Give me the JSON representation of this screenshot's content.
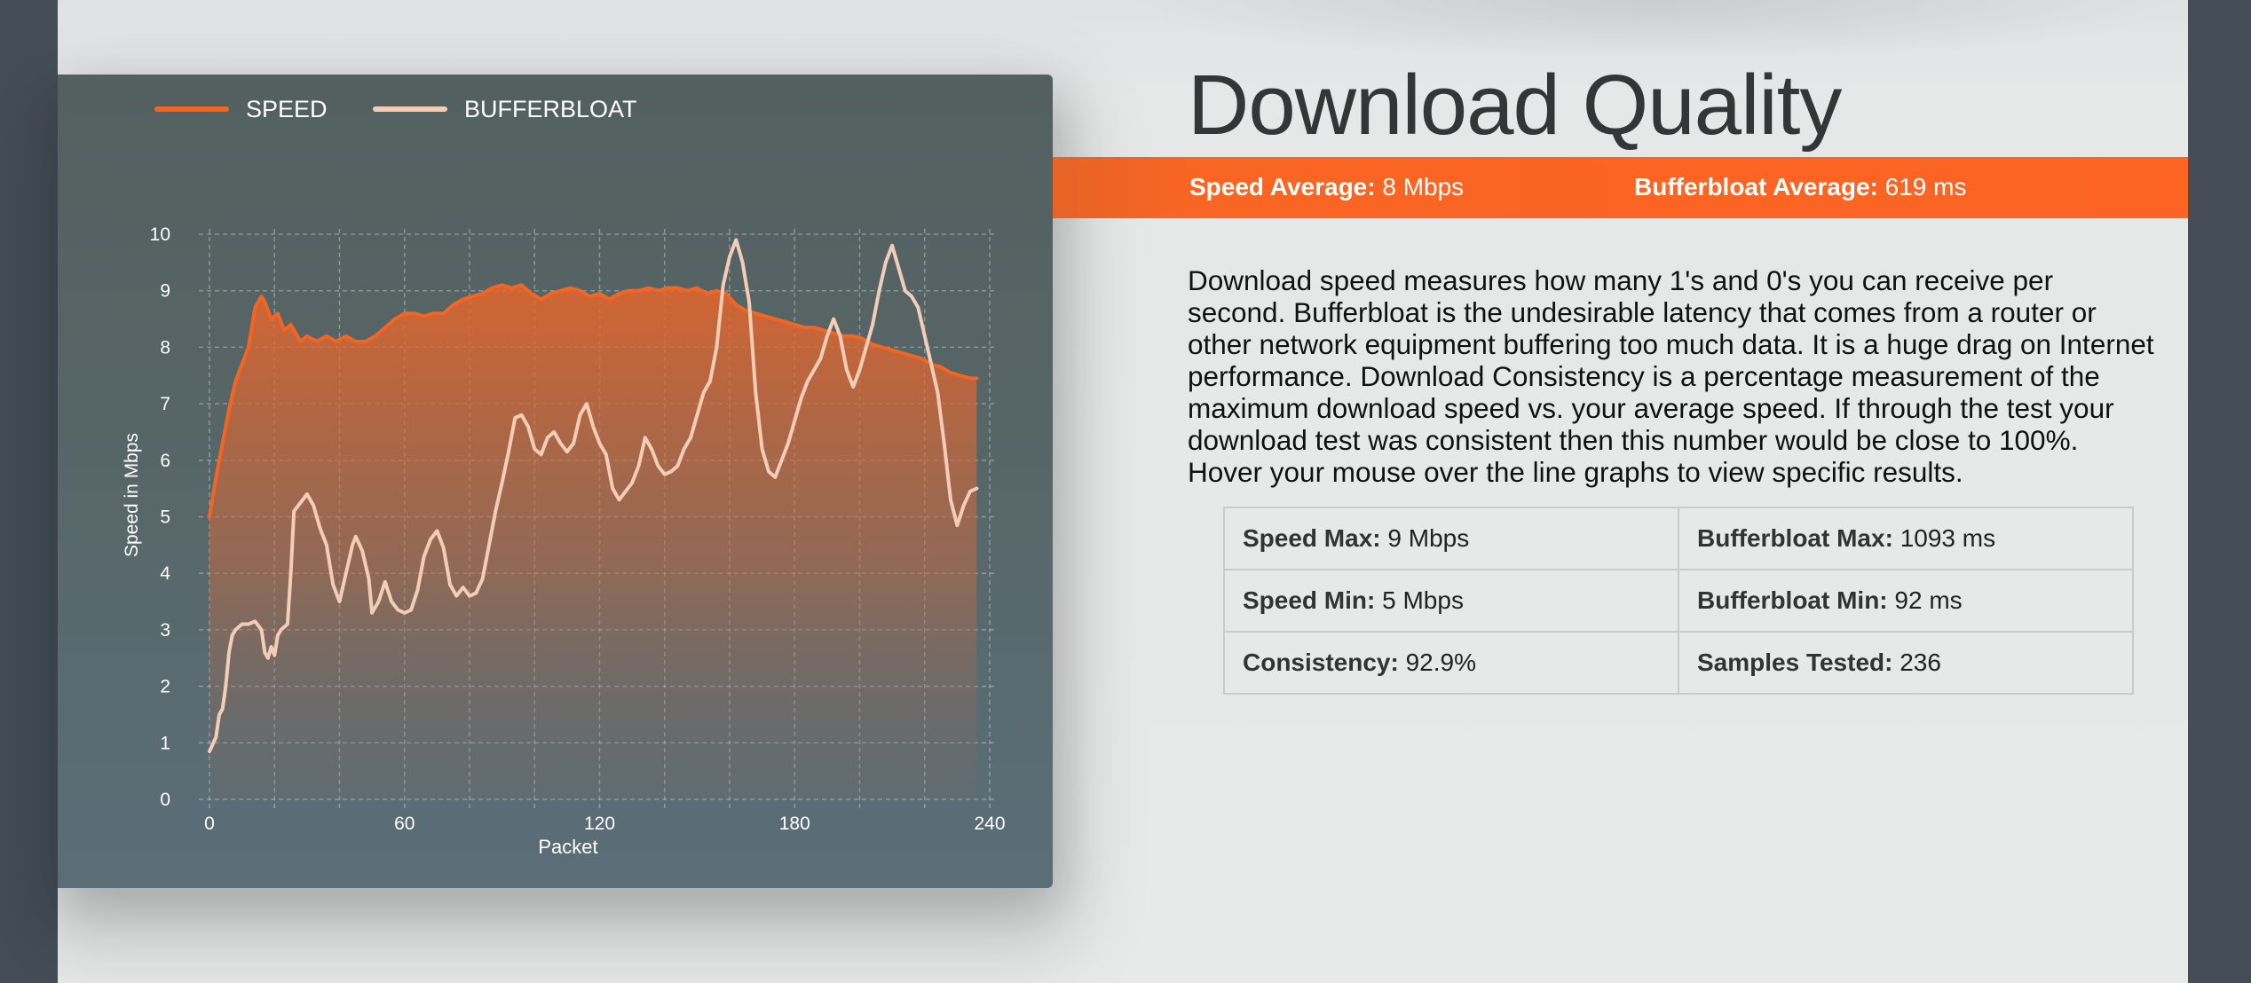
{
  "title": "Download Quality",
  "summary": {
    "speed_label": "Speed Average:",
    "speed_value": "8 Mbps",
    "bufferbloat_label": "Bufferbloat Average:",
    "bufferbloat_value": "619 ms"
  },
  "description": "Download speed measures how many 1's and 0's you can receive per second. Bufferbloat is the undesirable latency that comes from a router or other network equipment buffering too much data. It is a huge drag on Internet performance. Download Consistency is a percentage measurement of the maximum download speed vs. your average speed. If through the test your download test was consistent then this number would be close to 100%. Hover your mouse over the line graphs to view specific results.",
  "stats": [
    [
      {
        "label": "Speed Max:",
        "value": "9 Mbps"
      },
      {
        "label": "Bufferbloat Max:",
        "value": "1093 ms"
      }
    ],
    [
      {
        "label": "Speed Min:",
        "value": "5 Mbps"
      },
      {
        "label": "Bufferbloat Min:",
        "value": "92 ms"
      }
    ],
    [
      {
        "label": "Consistency:",
        "value": "92.9%"
      },
      {
        "label": "Samples Tested:",
        "value": "236"
      }
    ]
  ],
  "colors": {
    "accent": "#fd6423",
    "speed_line": "#f26522",
    "bufferbloat_line": "#f3cdb8",
    "chart_bg": "#566566"
  },
  "chart_data": {
    "type": "line",
    "title": "",
    "xlabel": "Packet",
    "ylabel": "Speed in Mbps",
    "xlim": [
      0,
      240
    ],
    "ylim": [
      0,
      10
    ],
    "x_ticks": [
      0,
      60,
      120,
      180,
      240
    ],
    "y_ticks": [
      0,
      1,
      2,
      3,
      4,
      5,
      6,
      7,
      8,
      9,
      10
    ],
    "grid": true,
    "legend_position": "top-left",
    "series": [
      {
        "name": "SPEED",
        "color": "#f26522",
        "fill": true,
        "x": [
          0,
          2,
          4,
          6,
          8,
          10,
          12,
          14,
          16,
          17,
          19,
          21,
          23,
          25,
          28,
          30,
          33,
          36,
          39,
          42,
          45,
          48,
          51,
          54,
          57,
          60,
          63,
          66,
          69,
          72,
          75,
          78,
          81,
          84,
          87,
          90,
          93,
          96,
          99,
          102,
          105,
          108,
          111,
          114,
          117,
          120,
          123,
          126,
          129,
          132,
          135,
          138,
          141,
          144,
          147,
          150,
          153,
          156,
          159,
          162,
          165,
          168,
          171,
          174,
          177,
          180,
          183,
          186,
          189,
          192,
          195,
          198,
          201,
          204,
          207,
          210,
          213,
          216,
          219,
          222,
          225,
          228,
          231,
          234,
          236
        ],
        "y": [
          5,
          5.7,
          6.3,
          6.9,
          7.4,
          7.7,
          8.0,
          8.7,
          8.9,
          8.8,
          8.5,
          8.6,
          8.3,
          8.4,
          8.1,
          8.2,
          8.1,
          8.2,
          8.1,
          8.2,
          8.1,
          8.1,
          8.2,
          8.35,
          8.5,
          8.6,
          8.6,
          8.55,
          8.6,
          8.6,
          8.75,
          8.85,
          8.9,
          8.95,
          9.05,
          9.1,
          9.05,
          9.1,
          8.95,
          8.85,
          8.95,
          9.0,
          9.05,
          9.0,
          8.9,
          8.95,
          8.85,
          8.95,
          9.0,
          9.0,
          9.05,
          9.0,
          9.05,
          9.05,
          9.0,
          9.05,
          8.95,
          9.0,
          8.95,
          8.75,
          8.65,
          8.6,
          8.55,
          8.5,
          8.45,
          8.4,
          8.35,
          8.35,
          8.3,
          8.25,
          8.2,
          8.2,
          8.15,
          8.05,
          8.0,
          7.95,
          7.9,
          7.85,
          7.8,
          7.7,
          7.65,
          7.55,
          7.5,
          7.45,
          7.45
        ]
      },
      {
        "name": "BUFFERBLOAT",
        "color": "#f3cdb8",
        "fill": false,
        "x": [
          0,
          2,
          3,
          4,
          5,
          6,
          7,
          8,
          10,
          12,
          14,
          16,
          17,
          18,
          19,
          20,
          21,
          22,
          24,
          25,
          26,
          28,
          30,
          32,
          34,
          36,
          38,
          40,
          42,
          44,
          45,
          47,
          49,
          50,
          52,
          54,
          56,
          58,
          60,
          62,
          64,
          66,
          68,
          70,
          72,
          74,
          76,
          78,
          80,
          82,
          84,
          86,
          88,
          90,
          92,
          94,
          96,
          98,
          100,
          102,
          104,
          106,
          108,
          110,
          112,
          114,
          116,
          118,
          120,
          122,
          124,
          126,
          128,
          130,
          132,
          134,
          136,
          138,
          140,
          142,
          144,
          146,
          148,
          150,
          152,
          154,
          156,
          158,
          160,
          162,
          164,
          166,
          168,
          170,
          172,
          174,
          176,
          178,
          180,
          182,
          184,
          186,
          188,
          190,
          192,
          194,
          196,
          198,
          200,
          202,
          204,
          206,
          208,
          210,
          212,
          214,
          216,
          218,
          220,
          222,
          224,
          226,
          228,
          230,
          232,
          234,
          236
        ],
        "y": [
          0.85,
          1.1,
          1.5,
          1.6,
          2.0,
          2.6,
          2.9,
          3.0,
          3.1,
          3.1,
          3.15,
          3.0,
          2.6,
          2.5,
          2.7,
          2.55,
          2.9,
          3.0,
          3.1,
          4.0,
          5.1,
          5.25,
          5.4,
          5.2,
          4.8,
          4.5,
          3.8,
          3.5,
          4.0,
          4.5,
          4.65,
          4.4,
          3.9,
          3.3,
          3.5,
          3.85,
          3.5,
          3.35,
          3.3,
          3.35,
          3.7,
          4.3,
          4.6,
          4.75,
          4.45,
          3.8,
          3.6,
          3.75,
          3.6,
          3.65,
          3.9,
          4.5,
          5.1,
          5.6,
          6.15,
          6.75,
          6.8,
          6.6,
          6.2,
          6.1,
          6.4,
          6.5,
          6.3,
          6.15,
          6.3,
          6.8,
          7.0,
          6.6,
          6.3,
          6.1,
          5.5,
          5.3,
          5.45,
          5.6,
          5.9,
          6.4,
          6.2,
          5.9,
          5.75,
          5.8,
          5.9,
          6.2,
          6.4,
          6.8,
          7.2,
          7.4,
          8.0,
          9.1,
          9.6,
          9.9,
          9.5,
          8.8,
          7.2,
          6.2,
          5.8,
          5.7,
          6.0,
          6.3,
          6.7,
          7.1,
          7.4,
          7.6,
          7.8,
          8.2,
          8.5,
          8.2,
          7.6,
          7.3,
          7.6,
          8.0,
          8.4,
          9.0,
          9.5,
          9.8,
          9.4,
          9.0,
          8.9,
          8.7,
          8.2,
          7.7,
          7.2,
          6.3,
          5.3,
          4.85,
          5.2,
          5.45,
          5.5
        ]
      }
    ]
  }
}
